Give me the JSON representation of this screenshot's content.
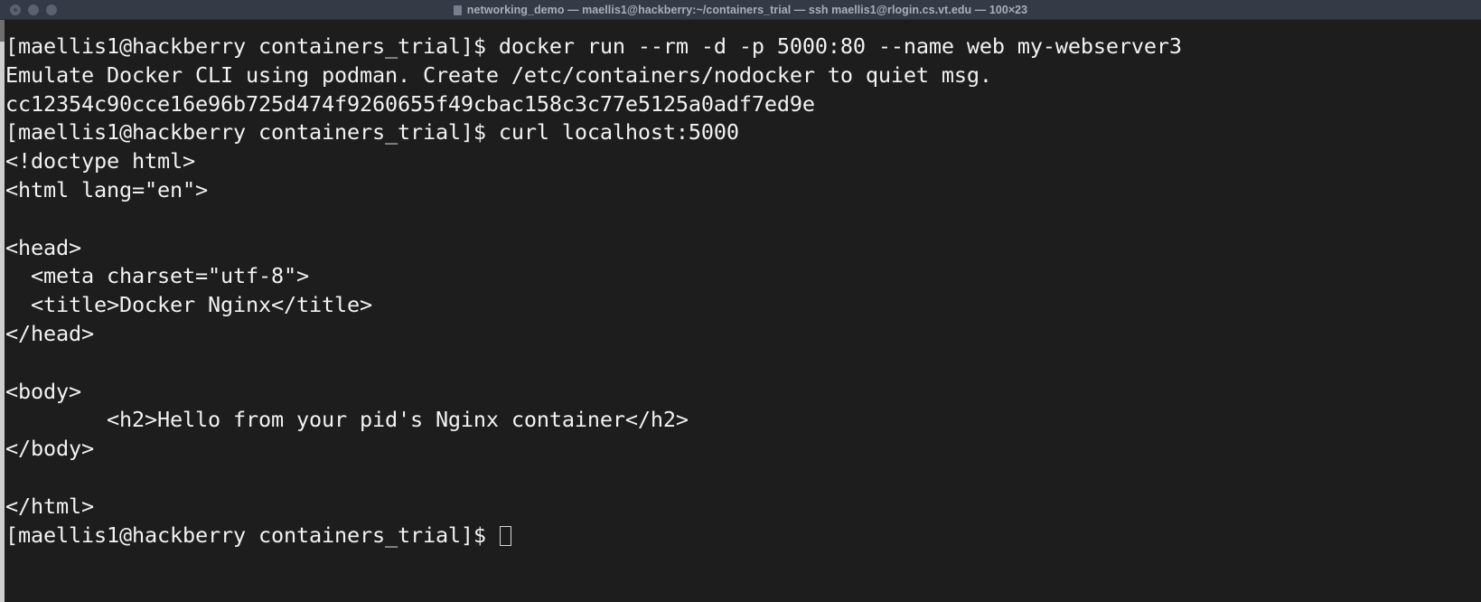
{
  "window": {
    "title": "networking_demo — maellis1@hackberry:~/containers_trial — ssh maellis1@rlogin.cs.vt.edu — 100×23",
    "traffic_lights": {
      "close_label": "Close",
      "minimize_label": "Minimize",
      "maximize_label": "Maximize"
    },
    "colors": {
      "titlebar_bg": "#343a46",
      "title_text": "#a8aeba",
      "terminal_bg": "#1d1d1d",
      "terminal_fg": "#f2f2f2",
      "traffic_light_inactive": "#5b616e",
      "scrollbar_track": "#cfcfcf",
      "scrollbar_thumb": "#6e6e6e"
    }
  },
  "terminal": {
    "columns": 100,
    "rows": 23,
    "prompt": "[maellis1@hackberry containers_trial]$ ",
    "lines": [
      "[maellis1@hackberry containers_trial]$ docker run --rm -d -p 5000:80 --name web my-webserver3",
      "Emulate Docker CLI using podman. Create /etc/containers/nodocker to quiet msg.",
      "cc12354c90cce16e96b725d474f9260655f49cbac158c3c77e5125a0adf7ed9e",
      "[maellis1@hackberry containers_trial]$ curl localhost:5000",
      "<!doctype html>",
      "<html lang=\"en\">",
      "",
      "<head>",
      "  <meta charset=\"utf-8\">",
      "  <title>Docker Nginx</title>",
      "</head>",
      "",
      "<body>",
      "        <h2>Hello from your pid's Nginx container</h2>",
      "</body>",
      "",
      "</html>"
    ],
    "last_line": {
      "prompt": "[maellis1@hackberry containers_trial]$ ",
      "input": "",
      "cursor": "block-outline-cursor"
    }
  }
}
